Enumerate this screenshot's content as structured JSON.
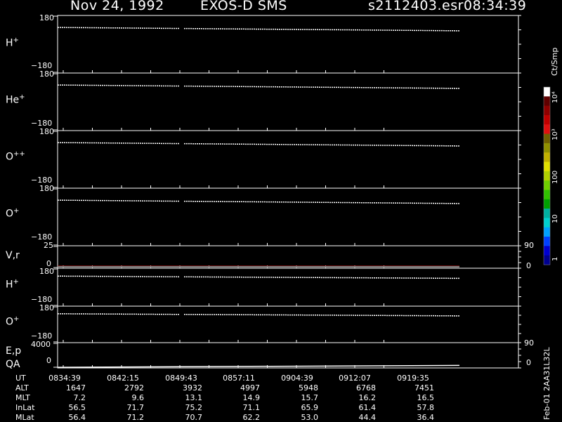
{
  "header": {
    "date": "Nov 24, 1992",
    "instrument": "EXOS-D SMS",
    "file": "s2112403.esr",
    "time": "08:34:39"
  },
  "panels": [
    {
      "label": "H",
      "sup": "+",
      "ytop": "180",
      "ybot": "−180"
    },
    {
      "label": "He",
      "sup": "+",
      "ytop": "180",
      "ybot": "−180"
    },
    {
      "label": "O",
      "sup": "++",
      "ytop": "180",
      "ybot": "−180"
    },
    {
      "label": "O",
      "sup": "+",
      "ytop": "180",
      "ybot": "−180"
    },
    {
      "label": "V,r",
      "sup": "",
      "ytop": "25",
      "ybot": "0",
      "rtop": "90",
      "rbot": "0"
    },
    {
      "label": "H",
      "sup": "+",
      "ytop": "180",
      "ybot": "−180"
    },
    {
      "label": "O",
      "sup": "+",
      "ytop": "180",
      "ybot": "−180"
    },
    {
      "label": "E,p",
      "label2": "QA",
      "sup": "",
      "ytop": "4000",
      "ybot": "0",
      "rtop": "90",
      "rbot": "0"
    }
  ],
  "colorbar": {
    "unit": "Ct/Smp",
    "ticks": [
      "1",
      "10",
      "100",
      "10³",
      "10⁴"
    ],
    "colors": [
      "#000090",
      "#0000d0",
      "#0040ff",
      "#00a0ff",
      "#00d0d0",
      "#00b0a0",
      "#00a000",
      "#30c000",
      "#70d000",
      "#b0d000",
      "#e0e000",
      "#c0b000",
      "#909000",
      "#706000",
      "#e01010",
      "#c00000",
      "#900000",
      "#600000",
      "#ffffff"
    ]
  },
  "ephemeris": {
    "row_labels": [
      "UT",
      "ALT",
      "MLT",
      "InLat",
      "MLat"
    ],
    "columns": [
      [
        "0834:39",
        "1647",
        "7.2",
        "56.5",
        "56.4"
      ],
      [
        "0842:15",
        "2792",
        "9.6",
        "71.7",
        "71.2"
      ],
      [
        "0849:43",
        "3932",
        "13.1",
        "75.2",
        "70.7"
      ],
      [
        "0857:11",
        "4997",
        "14.9",
        "71.1",
        "62.2"
      ],
      [
        "0904:39",
        "5948",
        "15.7",
        "65.9",
        "53.0"
      ],
      [
        "0912:07",
        "6768",
        "16.2",
        "61.4",
        "44.4"
      ],
      [
        "0919:35",
        "7451",
        "16.5",
        "57.8",
        "36.4"
      ]
    ]
  },
  "version": "Feb-01 2AA31L32L",
  "chart_data": {
    "type": "line",
    "title": "Nov 24, 1992   EXOS-D SMS",
    "x_ticks": [
      "0834:39",
      "0842:15",
      "0849:43",
      "0857:11",
      "0904:39",
      "0912:07",
      "0919:35"
    ],
    "series": [
      {
        "name": "H+",
        "ylim": [
          -180,
          180
        ],
        "start": 105,
        "end": 84,
        "gap": [
          "0849:43",
          "0850:10"
        ]
      },
      {
        "name": "He+",
        "ylim": [
          -180,
          180
        ],
        "start": 105,
        "end": 84,
        "gap": [
          "0849:43",
          "0850:10"
        ]
      },
      {
        "name": "O++",
        "ylim": [
          -180,
          180
        ],
        "start": 105,
        "end": 84,
        "gap": [
          "0849:43",
          "0850:10"
        ]
      },
      {
        "name": "O+",
        "ylim": [
          -180,
          180
        ],
        "start": 105,
        "end": 84,
        "gap": [
          "0849:43",
          "0850:10"
        ]
      },
      {
        "name": "V,r",
        "ylim": [
          0,
          25
        ],
        "start": 2,
        "end": 2
      },
      {
        "name": "H+",
        "ylim": [
          -180,
          180
        ],
        "start": 105,
        "end": 84,
        "gap": [
          "0849:43",
          "0850:10"
        ]
      },
      {
        "name": "O+",
        "ylim": [
          -180,
          180
        ],
        "start": 105,
        "end": 84,
        "gap": [
          "0849:43",
          "0850:10"
        ]
      },
      {
        "name": "E,p",
        "ylim": [
          0,
          4000
        ],
        "start": 100,
        "end": 400
      }
    ]
  }
}
